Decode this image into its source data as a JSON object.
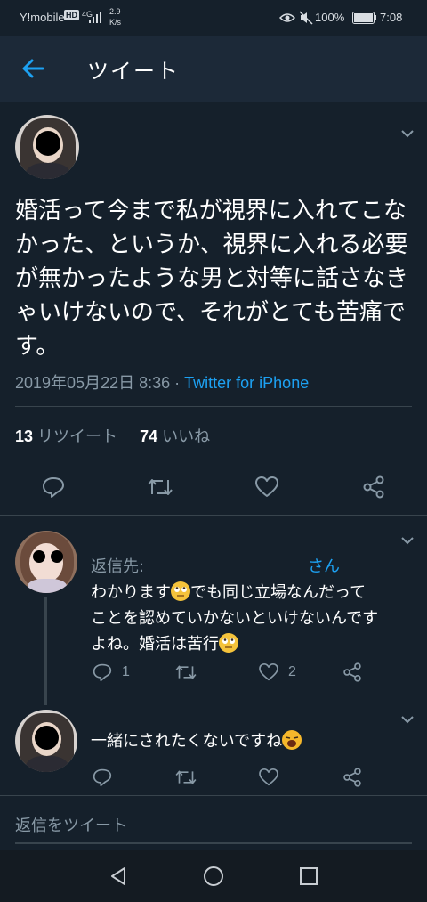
{
  "status_bar": {
    "carrier": "Y!mobile",
    "hd": "HD",
    "network": "4G",
    "speed_value": "2.9",
    "speed_unit": "K/s",
    "battery": "100%",
    "time": "7:08"
  },
  "header": {
    "title": "ツイート"
  },
  "tweet": {
    "text": "婚活って今まで私が視界に入れてこなかった、というか、視界に入れる必要が無かったような男と対等に話さなきゃいけないので、それがとても苦痛です。",
    "date": "2019年05月22日 8:36",
    "separator": "·",
    "source": "Twitter for iPhone",
    "retweet_count": "13",
    "retweet_label": "リツイート",
    "like_count": "74",
    "like_label": "いいね"
  },
  "reply1": {
    "reply_to_label": "返信先:",
    "reply_to_suffix": "さん",
    "text_parts": [
      "わかります",
      "でも同じ立場なんだって",
      "ことを認めていかないといけないんです",
      "よね。婚活は苦行"
    ],
    "reply_count": "1",
    "like_count": "2"
  },
  "reply2": {
    "text": "一緒にされたくないですね"
  },
  "compose": {
    "placeholder": "返信をツイート"
  },
  "colors": {
    "background": "#15202b",
    "header": "#1c2938",
    "accent": "#1da1f2",
    "muted": "#8899a6",
    "divider": "#38444d"
  },
  "icons": [
    "back-arrow-icon",
    "eye-icon",
    "mute-icon",
    "battery-icon",
    "chevron-down-icon",
    "reply-icon",
    "retweet-icon",
    "heart-icon",
    "share-icon",
    "nav-back-icon",
    "nav-home-icon",
    "nav-recents-icon"
  ]
}
